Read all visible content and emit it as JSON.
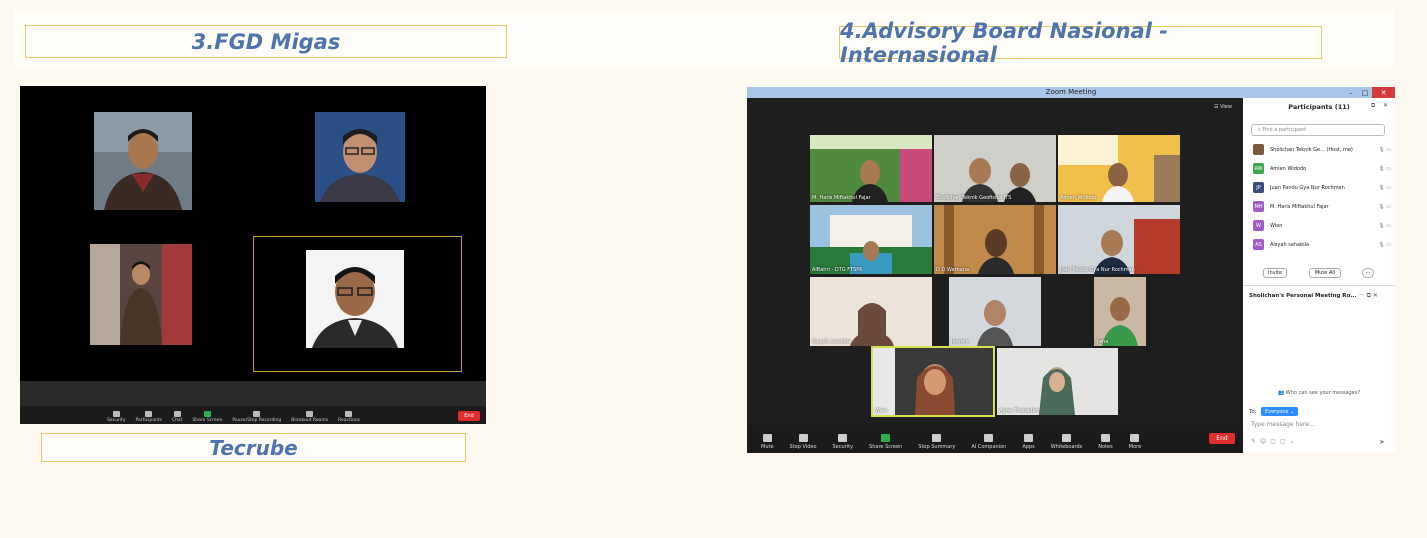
{
  "titles": {
    "left": "3.FGD Migas",
    "right": "4.Advisory Board Nasional - Internasional",
    "left_caption": "Tecrube"
  },
  "left_meeting": {
    "toolbar": [
      "Security",
      "Participants",
      "Chat",
      "Share Screen",
      "Pause/Stop Recording",
      "Breakout Rooms",
      "Reactions"
    ],
    "end_label": "End"
  },
  "right_meeting": {
    "window_title": "Zoom Meeting",
    "view_label": "View",
    "tiles": [
      "M. Haris Miftakhul Fajar",
      "Sholichan Teknik Geofisika ITS",
      "Amien Widodo",
      "AlBahri - DTG FTSPK",
      "D D Warnana",
      "Juan Pandu Gya Nur Rochman",
      "Aisyah sahabila",
      "Jeremy",
      "yana",
      "Wien",
      "Agnis Triahadini"
    ],
    "toolbar": [
      "Mute",
      "Stop Video",
      "Security",
      "Share Screen",
      "Stop Summary",
      "AI Companion",
      "Apps",
      "Whiteboards",
      "Notes",
      "More"
    ],
    "end_label": "End",
    "participants": {
      "header": "Participants (11)",
      "search_placeholder": "Find a participant",
      "rows": [
        {
          "initials": "",
          "name": "Sholichan Teknik Ge... (Host, me)",
          "color": "#7a5a3a"
        },
        {
          "initials": "AW",
          "name": "Amien Widodo",
          "color": "#3fa84a"
        },
        {
          "initials": "JP",
          "name": "Juan Pandu Gya Nur Rochman",
          "color": "#3a4a7a"
        },
        {
          "initials": "MH",
          "name": "M. Haris Miftakhul Fajar",
          "color": "#a25bc7"
        },
        {
          "initials": "W",
          "name": "Wien",
          "color": "#a25bc7"
        },
        {
          "initials": "AS",
          "name": "Aisyah sahabila",
          "color": "#a25bc7"
        }
      ],
      "invite": "Invite",
      "mute_all": "Mute All",
      "more": "···"
    },
    "chat": {
      "header": "Sholichan's Personal Meeting Ro...",
      "who_can_see": "Who can see your messages?",
      "to_label": "To:",
      "recipient": "Everyone",
      "input_placeholder": "Type message here..."
    }
  }
}
